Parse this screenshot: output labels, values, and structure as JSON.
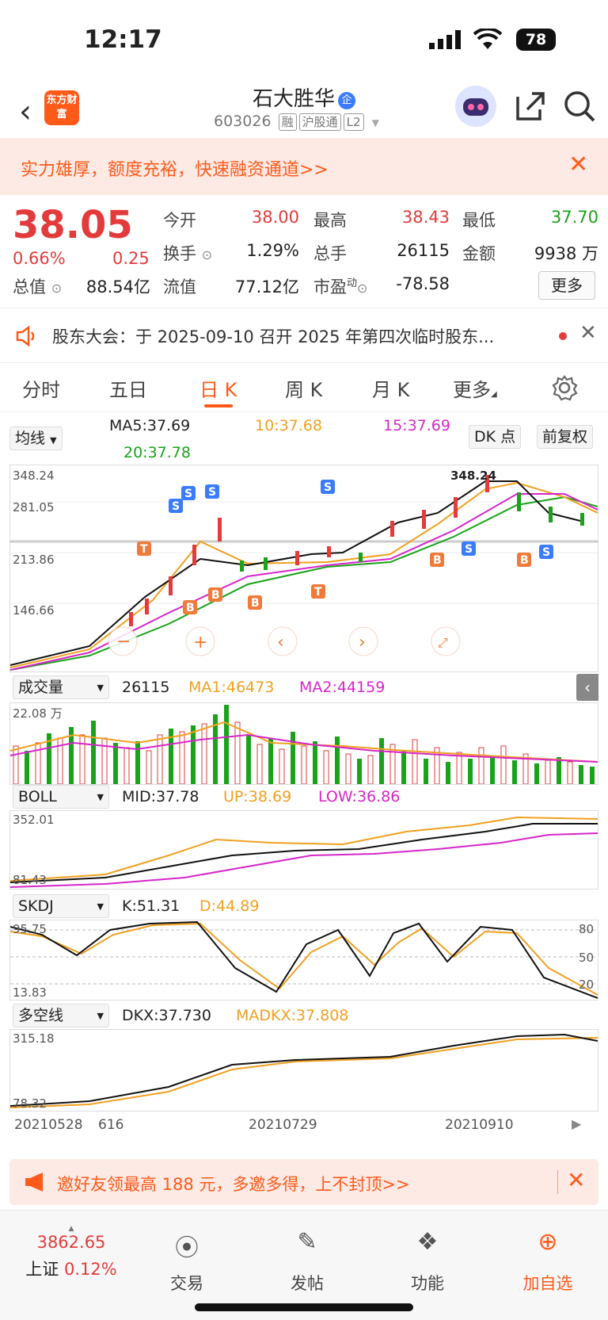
{
  "status_bar": {
    "time": "12:17",
    "battery": "78"
  },
  "header": {
    "title": "石大胜华",
    "badge": "企",
    "code": "603026",
    "tags": [
      "融",
      "沪股通",
      "L2"
    ],
    "logo_text": "东方财富"
  },
  "banner": {
    "text": "实力雄厚，额度充裕，快速融资通道>>"
  },
  "quote": {
    "price": "38.05",
    "pct": "0.66%",
    "change": "0.25",
    "fields": [
      {
        "label": "今开",
        "value": "38.00",
        "color": "red"
      },
      {
        "label": "最高",
        "value": "38.43",
        "color": "red"
      },
      {
        "label": "最低",
        "value": "37.70",
        "color": "green"
      },
      {
        "label": "换手",
        "value": "1.29%",
        "color": "dark"
      },
      {
        "label": "总手",
        "value": "26115",
        "color": "dark"
      },
      {
        "label": "金额",
        "value": "9938 万",
        "color": "dark"
      },
      {
        "label": "总值",
        "value": "88.54亿",
        "color": "dark"
      },
      {
        "label": "流值",
        "value": "77.12亿",
        "color": "dark"
      },
      {
        "label": "市盈",
        "value": "-78.58",
        "color": "dark"
      }
    ],
    "pe_sup": "动",
    "more": "更多"
  },
  "notice": {
    "text": "股东大会：于 2025-09-10 召开 2025 年第四次临时股东..."
  },
  "tabs": [
    "分时",
    "五日",
    "日 K",
    "周 K",
    "月 K",
    "更多"
  ],
  "controls": {
    "ma_select": "均线",
    "dk": "DK 点",
    "adjust": "前复权",
    "ma5": "MA5:37.69",
    "ma10": "10:37.68",
    "ma15": "15:37.69",
    "ma20": "20:37.78"
  },
  "kline": {
    "axis": [
      "348.24",
      "281.05",
      "213.86",
      "146.66"
    ],
    "high_label": "348.24"
  },
  "volume": {
    "select": "成交量",
    "v": "26115",
    "ma1": "MA1:46473",
    "ma2": "MA2:44159",
    "axis_top": "22.08 万"
  },
  "boll": {
    "select": "BOLL",
    "mid": "MID:37.78",
    "up": "UP:38.69",
    "low": "LOW:36.86",
    "axis_top": "352.01",
    "axis_bottom": "81.43"
  },
  "skdj": {
    "select": "SKDJ",
    "k": "K:51.31",
    "d": "D:44.89",
    "axis_top": "95.75",
    "axis_bottom": "13.83",
    "levels": [
      "80",
      "50",
      "20"
    ]
  },
  "dkx": {
    "select": "多空线",
    "dkx": "DKX:37.730",
    "madkx": "MADKX:37.808",
    "axis_top": "315.18",
    "axis_bottom": "78.32"
  },
  "dates": [
    "20210528",
    "616",
    "20210729",
    "20210910"
  ],
  "bottom_banner": {
    "text": "邀好友领最高 188 元，多邀多得，上不封顶>>"
  },
  "tabbar": {
    "index_value": "3862.65",
    "index_name": "上证",
    "index_pct": "0.12%",
    "items": [
      "交易",
      "发帖",
      "功能",
      "加自选"
    ]
  },
  "colors": {
    "accent": "#ff5a1a",
    "up": "#e33b3b",
    "down": "#1aa31a",
    "ma10": "#f0a020",
    "ma15": "#d526c9"
  }
}
